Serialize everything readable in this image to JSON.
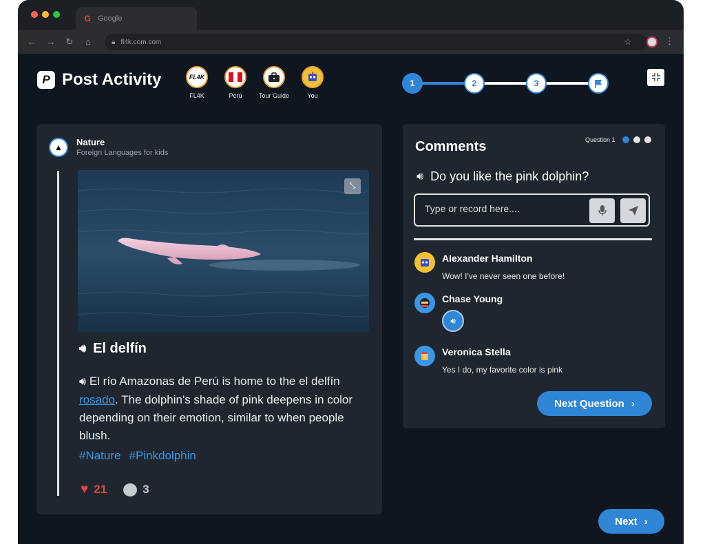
{
  "browser": {
    "tab_title": "Google",
    "url": "fl4k.com.com"
  },
  "header": {
    "title": "Post Activity",
    "chips": [
      {
        "label": "FL4K",
        "badge": "FL4K"
      },
      {
        "label": "Perú",
        "badge": ""
      },
      {
        "label": "Tour Guide",
        "badge": ""
      },
      {
        "label": "You",
        "badge": ""
      }
    ],
    "steps": [
      "1",
      "2",
      "3"
    ],
    "active_step": 1
  },
  "post": {
    "author": "Nature",
    "subtitle": "Foreign Languages for kids",
    "title": "El delfín",
    "body_before_link": "El río Amazonas de Perú is home to the el delfín ",
    "body_link": "rosado",
    "body_after_link": ". The dolphin's shade of pink deepens in color depending on their emotion, similar to when people blush.",
    "tags": [
      "#Nature",
      "#Pinkdolphin"
    ],
    "likes": "21",
    "comments_count": "3"
  },
  "comments": {
    "title": "Comments",
    "question_label": "Question 1",
    "question": "Do you like the pink dolphin?",
    "input_placeholder": "Type or record here....",
    "items": [
      {
        "name": "Alexander Hamilton",
        "text": "Wow! I've never seen one before!"
      },
      {
        "name": "Chase Young",
        "text": ""
      },
      {
        "name": "Veronica Stella",
        "text": "Yes I do, my favorite color is pink"
      }
    ],
    "next_question_label": "Next Question"
  },
  "footer": {
    "next_label": "Next"
  },
  "colors": {
    "accent": "#2f86d6",
    "background": "#0f1620",
    "panel": "#1f2630",
    "likes": "#e2463f"
  }
}
